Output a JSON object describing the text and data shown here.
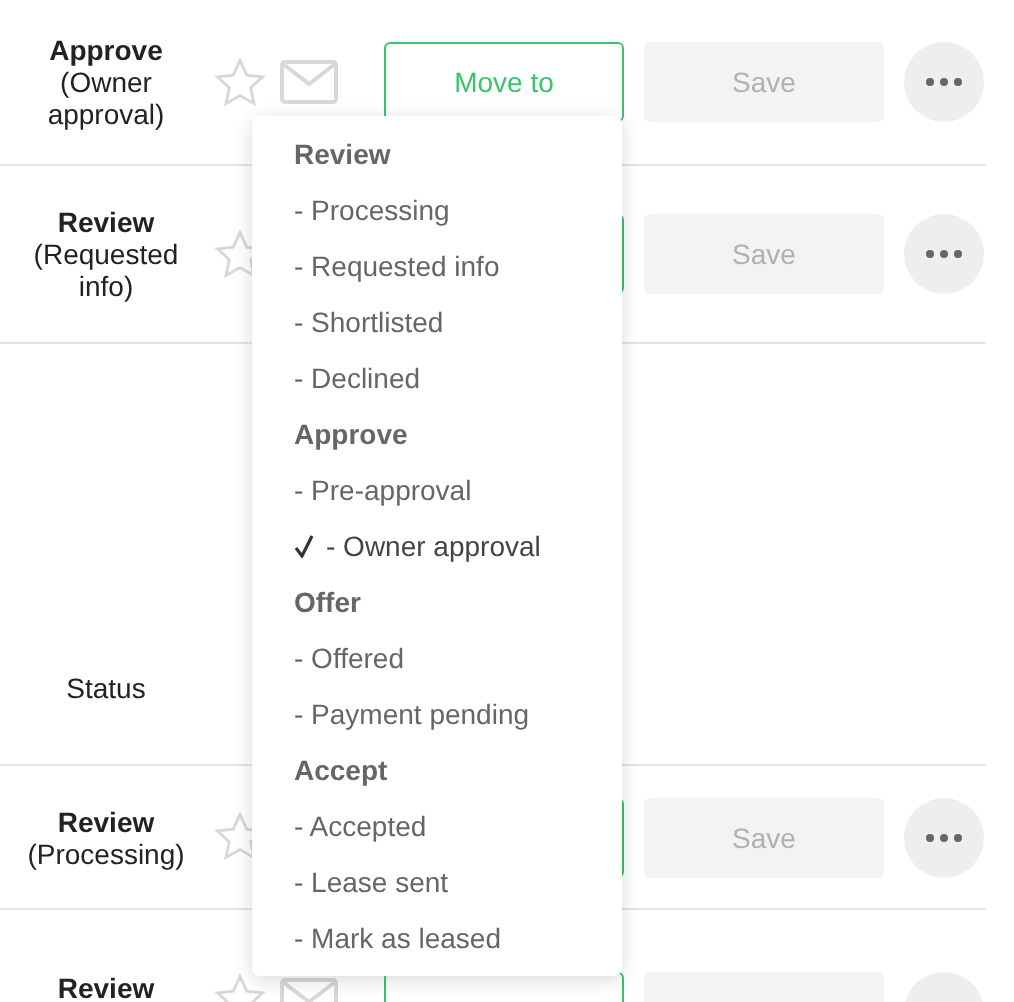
{
  "rows": [
    {
      "kind": "candidate",
      "stage": "Approve",
      "substage": "(Owner approval)",
      "move_button": "Move to",
      "save_button": "Save"
    },
    {
      "kind": "candidate",
      "stage": "Review",
      "substage": "(Requested info)",
      "save_button": "Save"
    },
    {
      "kind": "status",
      "label": "Status"
    },
    {
      "kind": "candidate",
      "stage": "Review",
      "substage": "(Processing)",
      "save_button": "Save"
    },
    {
      "kind": "candidate",
      "stage": "Review"
    }
  ],
  "dropdown": {
    "items": [
      {
        "kind": "header",
        "label": "Review"
      },
      {
        "kind": "option",
        "label": "- Processing",
        "selected": false
      },
      {
        "kind": "option",
        "label": "- Requested info",
        "selected": false
      },
      {
        "kind": "option",
        "label": "- Shortlisted",
        "selected": false
      },
      {
        "kind": "option",
        "label": "- Declined",
        "selected": false
      },
      {
        "kind": "header",
        "label": "Approve"
      },
      {
        "kind": "option",
        "label": "- Pre-approval",
        "selected": false
      },
      {
        "kind": "option",
        "label": "- Owner approval",
        "selected": true
      },
      {
        "kind": "header",
        "label": "Offer"
      },
      {
        "kind": "option",
        "label": "- Offered",
        "selected": false
      },
      {
        "kind": "option",
        "label": "- Payment pending",
        "selected": false
      },
      {
        "kind": "header",
        "label": "Accept"
      },
      {
        "kind": "option",
        "label": "- Accepted",
        "selected": false
      },
      {
        "kind": "option",
        "label": "- Lease sent",
        "selected": false
      },
      {
        "kind": "option",
        "label": "- Mark as leased",
        "selected": false
      }
    ]
  }
}
